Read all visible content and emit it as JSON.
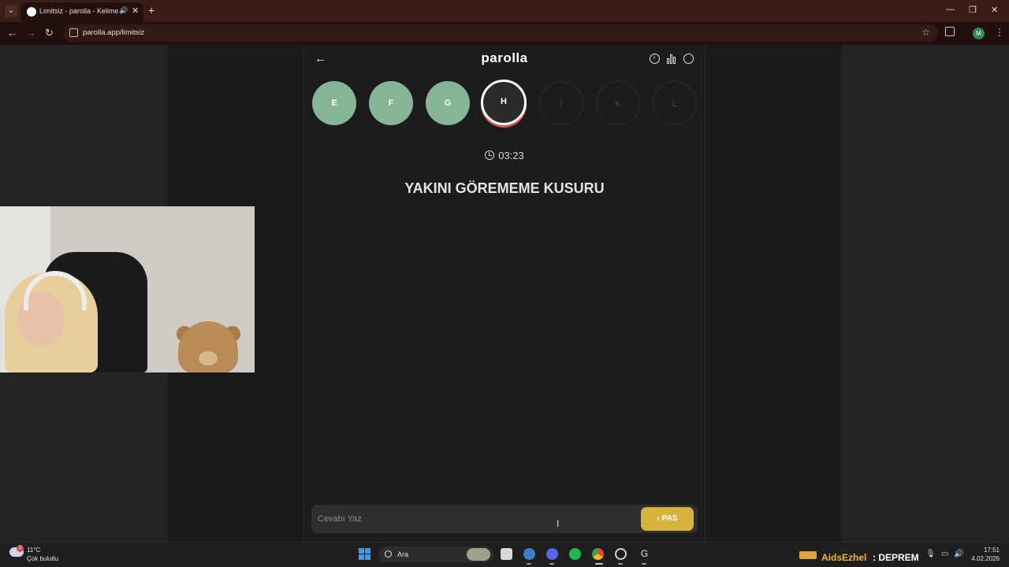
{
  "browser": {
    "tab_title": "Limitsiz - parolla - Kelime o",
    "url": "parolla.app/limitsiz",
    "profile_initial": "M"
  },
  "app": {
    "brand": "parolla",
    "letters": [
      {
        "label": "E",
        "state": "done"
      },
      {
        "label": "F",
        "state": "done"
      },
      {
        "label": "G",
        "state": "done"
      },
      {
        "label": "H",
        "state": "current"
      },
      {
        "label": "İ",
        "state": "todo"
      },
      {
        "label": "K",
        "state": "todo"
      },
      {
        "label": "L",
        "state": "todo"
      }
    ],
    "timer": "03:23",
    "question": "YAKINI GÖREMEME KUSURU",
    "answer_placeholder": "Cevabı Yaz",
    "pass_label": "PAS"
  },
  "taskbar": {
    "weather_temp": "11°C",
    "weather_desc": "Çok bulutlu",
    "weather_badge": "2",
    "search_label": "Ara",
    "stream_user": "AidsEzhel",
    "stream_message": ": DEPREM",
    "time": "17:51",
    "date": "4.02.2026"
  },
  "colors": {
    "done": "#86b596",
    "current_ring": "#ffffff",
    "current_underline": "#d9534f",
    "pass_button": "#d8b33c",
    "chrome_frame": "#3b1d17"
  }
}
